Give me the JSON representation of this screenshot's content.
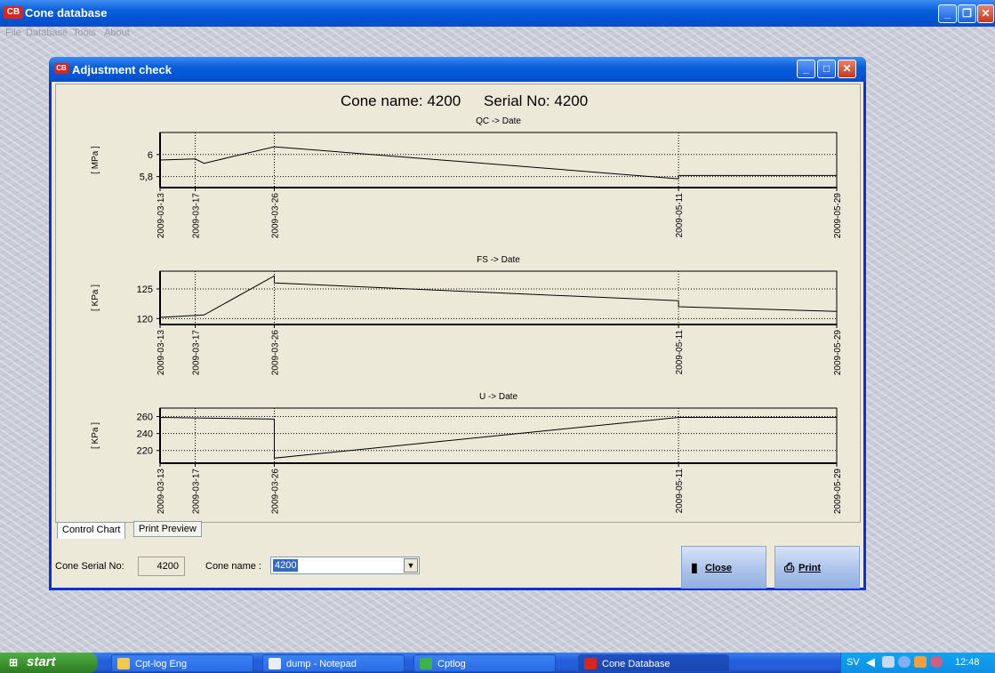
{
  "app": {
    "title": "Cone database",
    "icon_text": "CB",
    "menu": [
      "File",
      "Database",
      "Tools",
      "About"
    ]
  },
  "dialog": {
    "title": "Adjustment check",
    "icon_text": "CB",
    "header_cone": "Cone name: 4200",
    "header_serial": "Serial No: 4200"
  },
  "chart_data": [
    {
      "type": "line",
      "title": "QC -> Date",
      "ylabel": "[ MPa ]",
      "x_ticks": [
        "2009-03-13",
        "2009-03-17",
        "2009-03-26",
        "2009-05-11",
        "2009-05-29"
      ],
      "xlim": [
        "2009-03-13",
        "2009-05-29"
      ],
      "ylim": [
        5.7,
        6.2
      ],
      "y_ticks": [
        "6",
        "5,8"
      ],
      "y_tick_values": [
        6.0,
        5.8
      ],
      "grid": true,
      "points": [
        {
          "x": "2009-03-13",
          "y": 5.91
        },
        {
          "x": "2009-03-13",
          "y": 5.95
        },
        {
          "x": "2009-03-17",
          "y": 5.96
        },
        {
          "x": "2009-03-18",
          "y": 5.92
        },
        {
          "x": "2009-03-26",
          "y": 6.07
        },
        {
          "x": "2009-05-11",
          "y": 5.78
        },
        {
          "x": "2009-05-11",
          "y": 5.81
        },
        {
          "x": "2009-05-29",
          "y": 5.81
        }
      ]
    },
    {
      "type": "line",
      "title": "FS -> Date",
      "ylabel": "[ KPa ]",
      "x_ticks": [
        "2009-03-13",
        "2009-03-17",
        "2009-03-26",
        "2009-05-11",
        "2009-05-29"
      ],
      "xlim": [
        "2009-03-13",
        "2009-05-29"
      ],
      "ylim": [
        119,
        128
      ],
      "y_ticks": [
        "125",
        "120"
      ],
      "y_tick_values": [
        125,
        120
      ],
      "grid": true,
      "points": [
        {
          "x": "2009-03-13",
          "y": 119.8
        },
        {
          "x": "2009-03-13",
          "y": 120.2
        },
        {
          "x": "2009-03-18",
          "y": 120.6
        },
        {
          "x": "2009-03-26",
          "y": 127.2
        },
        {
          "x": "2009-03-26",
          "y": 126.0
        },
        {
          "x": "2009-05-11",
          "y": 123.0
        },
        {
          "x": "2009-05-11",
          "y": 122.0
        },
        {
          "x": "2009-05-29",
          "y": 121.2
        }
      ]
    },
    {
      "type": "line",
      "title": "U -> Date",
      "ylabel": "[ KPa ]",
      "x_ticks": [
        "2009-03-13",
        "2009-03-17",
        "2009-03-26",
        "2009-05-11",
        "2009-05-29"
      ],
      "xlim": [
        "2009-03-13",
        "2009-05-29"
      ],
      "ylim": [
        205,
        270
      ],
      "y_ticks": [
        "260",
        "240",
        "220"
      ],
      "y_tick_values": [
        260,
        240,
        220
      ],
      "grid": true,
      "points": [
        {
          "x": "2009-03-13",
          "y": 257
        },
        {
          "x": "2009-03-13",
          "y": 259
        },
        {
          "x": "2009-03-26",
          "y": 257
        },
        {
          "x": "2009-03-26",
          "y": 211
        },
        {
          "x": "2009-05-11",
          "y": 259
        },
        {
          "x": "2009-05-29",
          "y": 259
        }
      ]
    }
  ],
  "tabs": [
    "Control Chart",
    "Print Preview"
  ],
  "form": {
    "serial_label": "Cone Serial No:",
    "serial_value": "4200",
    "cone_label": "Cone name :",
    "cone_value": "4200"
  },
  "buttons": {
    "close": "Close",
    "print": "Print"
  },
  "taskbar": {
    "start": "start",
    "items": [
      "Cpt-log Eng",
      "dump - Notepad",
      "Cptlog",
      "Cone Database"
    ],
    "lang": "SV",
    "clock": "12:48"
  }
}
